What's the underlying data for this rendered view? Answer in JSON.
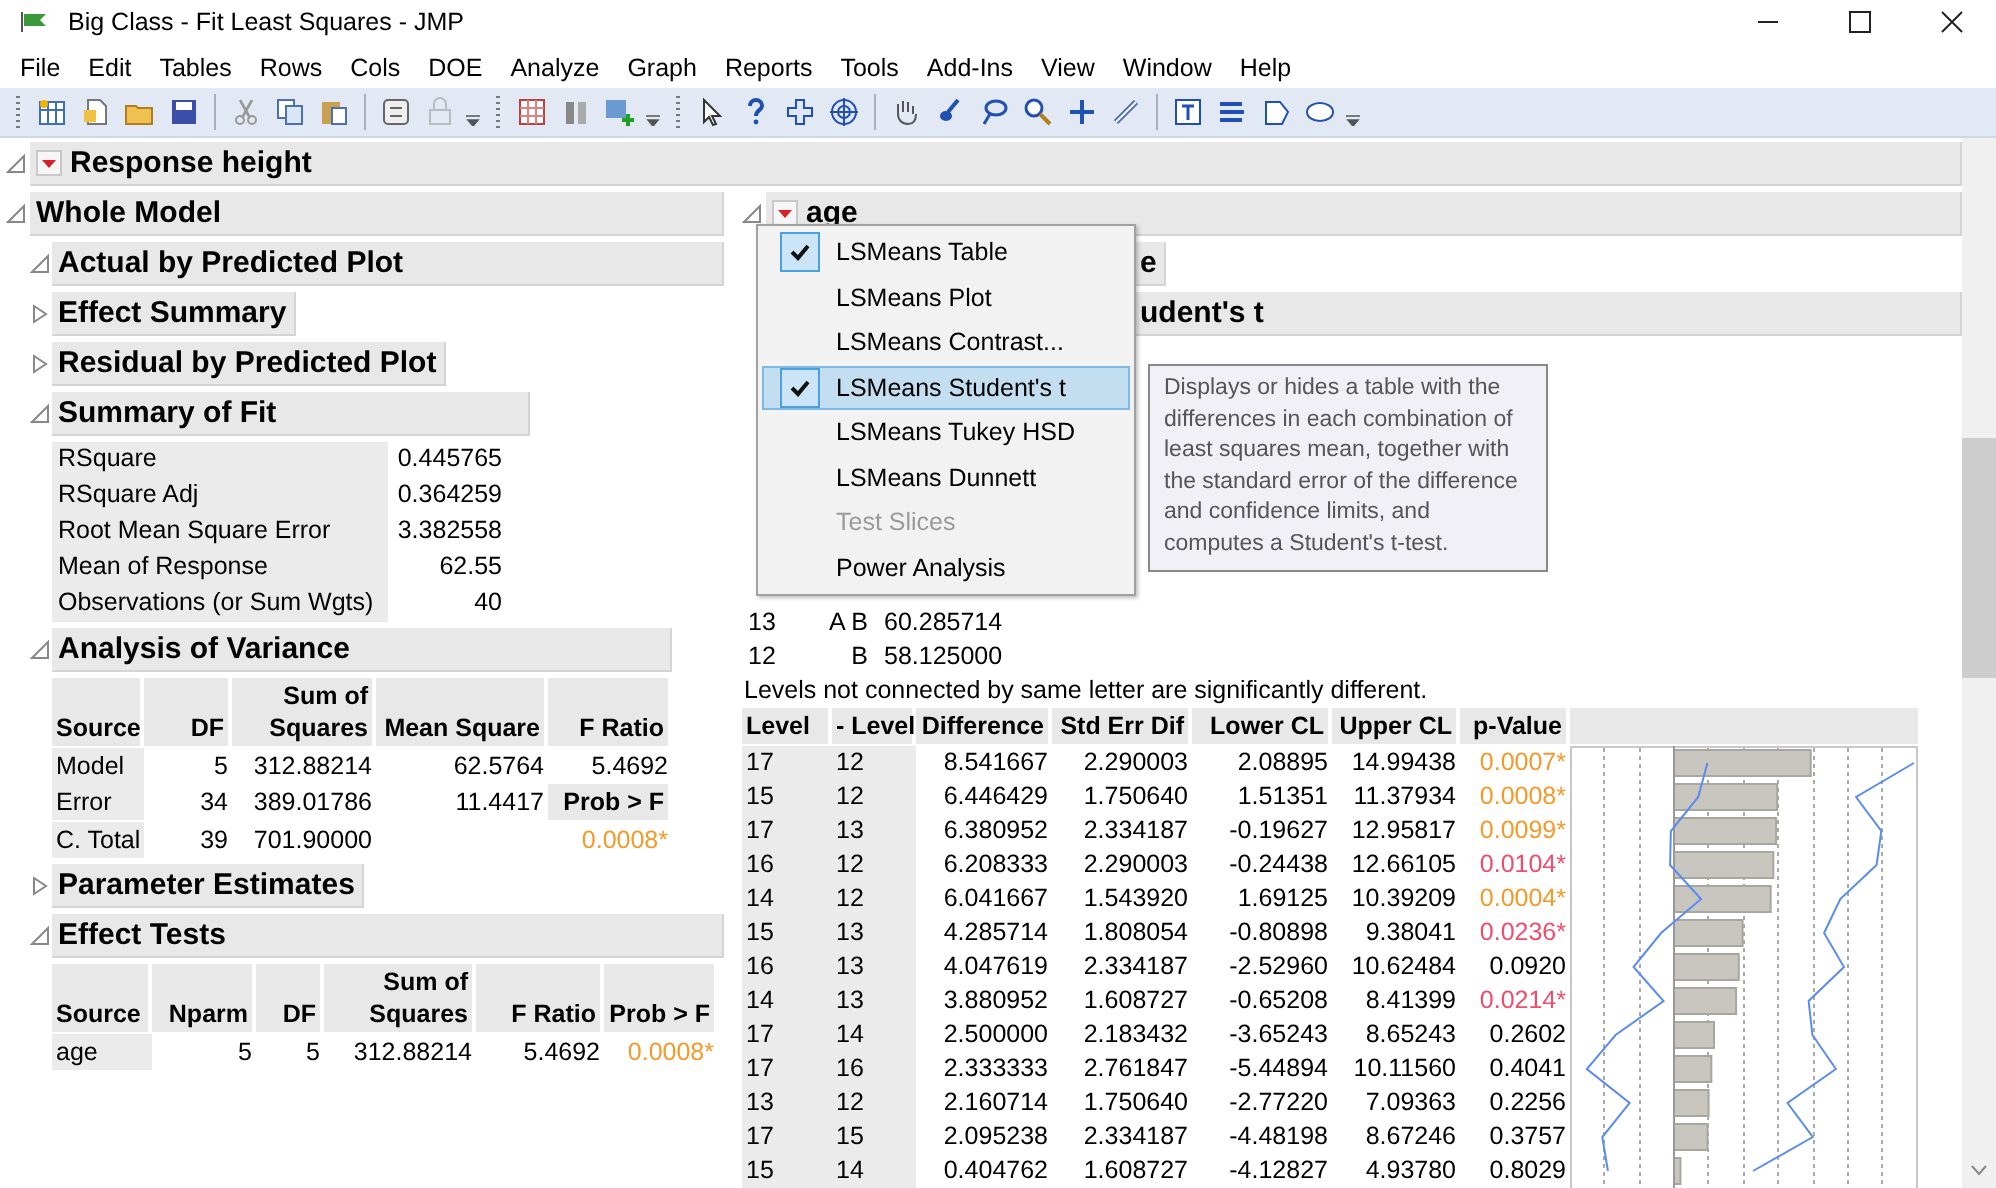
{
  "window": {
    "title": "Big Class - Fit Least Squares - JMP"
  },
  "menu": [
    "File",
    "Edit",
    "Tables",
    "Rows",
    "Cols",
    "DOE",
    "Analyze",
    "Graph",
    "Reports",
    "Tools",
    "Add-Ins",
    "View",
    "Window",
    "Help"
  ],
  "report": {
    "title": "Response height",
    "expanded": true
  },
  "whole_model": {
    "title": "Whole Model",
    "expanded": true
  },
  "sections": [
    {
      "title": "Actual by Predicted Plot",
      "expanded": true,
      "kind": "plot"
    },
    {
      "title": "Effect Summary",
      "expanded": false,
      "kind": "closed"
    },
    {
      "title": "Residual by Predicted Plot",
      "expanded": false,
      "kind": "closed"
    },
    {
      "title": "Summary of Fit",
      "expanded": true,
      "kind": "summary",
      "rows": [
        {
          "label": "RSquare",
          "value": "0.445765"
        },
        {
          "label": "RSquare Adj",
          "value": "0.364259"
        },
        {
          "label": "Root Mean Square Error",
          "value": "3.382558"
        },
        {
          "label": "Mean of Response",
          "value": "62.55"
        },
        {
          "label": "Observations (or Sum Wgts)",
          "value": "40"
        }
      ]
    },
    {
      "title": "Analysis of Variance",
      "expanded": true,
      "kind": "anova",
      "columns": [
        "Source",
        "DF",
        "Sum of Squares",
        "Mean Square",
        "F Ratio"
      ],
      "rows": [
        {
          "source": "Model",
          "df": "5",
          "ss": "312.88214",
          "ms": "62.5764",
          "f": "5.4692"
        },
        {
          "source": "Error",
          "df": "34",
          "ss": "389.01786",
          "ms": "11.4417",
          "f_header": "Prob > F"
        },
        {
          "source": "C. Total",
          "df": "39",
          "ss": "701.90000",
          "f_value": "0.0008*",
          "color": "#f39a2a"
        }
      ]
    },
    {
      "title": "Parameter Estimates",
      "expanded": false,
      "kind": "closed"
    },
    {
      "title": "Effect Tests",
      "expanded": true,
      "kind": "tests",
      "columns": [
        "Source",
        "Nparm",
        "DF",
        "Sum of Squares",
        "F Ratio",
        "Prob > F"
      ],
      "rows": [
        {
          "cells": [
            "age",
            "5",
            "5",
            "312.88214",
            "5.4692",
            "0.0008*"
          ],
          "color": "#f39a2a"
        }
      ]
    }
  ],
  "age": {
    "title": "age",
    "expanded": true
  },
  "partial_headers": [
    {
      "title": "e"
    },
    {
      "title": "udent's t"
    }
  ],
  "letters": [
    {
      "level": "13",
      "letters": "A B",
      "mean": "60.285714"
    },
    {
      "level": "12",
      "letters": "B",
      "mean": "58.125000"
    }
  ],
  "note": "Levels not connected by same letter are significantly different.",
  "diffs": {
    "columns": [
      "Level",
      "- Level",
      "Difference",
      "Std Err Dif",
      "Lower CL",
      "Upper CL",
      "p-Value"
    ],
    "rows": [
      {
        "level": "17",
        "minus_level": "12",
        "difference": "8.541667",
        "std_err_dif": "2.290003",
        "lower_cl": "2.08895",
        "upper_cl": "14.99438",
        "p_value": "0.0007*",
        "color": "#f39a2a"
      },
      {
        "level": "15",
        "minus_level": "12",
        "difference": "6.446429",
        "std_err_dif": "1.750640",
        "lower_cl": "1.51351",
        "upper_cl": "11.37934",
        "p_value": "0.0008*",
        "color": "#f39a2a"
      },
      {
        "level": "17",
        "minus_level": "13",
        "difference": "6.380952",
        "std_err_dif": "2.334187",
        "lower_cl": "-0.19627",
        "upper_cl": "12.95817",
        "p_value": "0.0099*",
        "color": "#f39a2a"
      },
      {
        "level": "16",
        "minus_level": "12",
        "difference": "6.208333",
        "std_err_dif": "2.290003",
        "lower_cl": "-0.24438",
        "upper_cl": "12.66105",
        "p_value": "0.0104*",
        "color": "#f04c6c"
      },
      {
        "level": "14",
        "minus_level": "12",
        "difference": "6.041667",
        "std_err_dif": "1.543920",
        "lower_cl": "1.69125",
        "upper_cl": "10.39209",
        "p_value": "0.0004*",
        "color": "#f39a2a"
      },
      {
        "level": "15",
        "minus_level": "13",
        "difference": "4.285714",
        "std_err_dif": "1.808054",
        "lower_cl": "-0.80898",
        "upper_cl": "9.38041",
        "p_value": "0.0236*",
        "color": "#f04c6c"
      },
      {
        "level": "16",
        "minus_level": "13",
        "difference": "4.047619",
        "std_err_dif": "2.334187",
        "lower_cl": "-2.52960",
        "upper_cl": "10.62484",
        "p_value": "0.0920"
      },
      {
        "level": "14",
        "minus_level": "13",
        "difference": "3.880952",
        "std_err_dif": "1.608727",
        "lower_cl": "-0.65208",
        "upper_cl": "8.41399",
        "p_value": "0.0214*",
        "color": "#f04c6c"
      },
      {
        "level": "17",
        "minus_level": "14",
        "difference": "2.500000",
        "std_err_dif": "2.183432",
        "lower_cl": "-3.65243",
        "upper_cl": "8.65243",
        "p_value": "0.2602"
      },
      {
        "level": "17",
        "minus_level": "16",
        "difference": "2.333333",
        "std_err_dif": "2.761847",
        "lower_cl": "-5.44894",
        "upper_cl": "10.11560",
        "p_value": "0.4041"
      },
      {
        "level": "13",
        "minus_level": "12",
        "difference": "2.160714",
        "std_err_dif": "1.750640",
        "lower_cl": "-2.77220",
        "upper_cl": "7.09363",
        "p_value": "0.2256"
      },
      {
        "level": "17",
        "minus_level": "15",
        "difference": "2.095238",
        "std_err_dif": "2.334187",
        "lower_cl": "-4.48198",
        "upper_cl": "8.67246",
        "p_value": "0.3757"
      },
      {
        "level": "15",
        "minus_level": "14",
        "difference": "0.404762",
        "std_err_dif": "1.608727",
        "lower_cl": "-4.12827",
        "upper_cl": "4.93780",
        "p_value": "0.8029"
      }
    ]
  },
  "dropdown": {
    "items": [
      {
        "label": "LSMeans Table",
        "checked": true,
        "disabled": false,
        "selected": false
      },
      {
        "label": "LSMeans Plot",
        "checked": false,
        "disabled": false,
        "selected": false
      },
      {
        "label": "LSMeans Contrast...",
        "checked": false,
        "disabled": false,
        "selected": false
      },
      {
        "label": "LSMeans Student's t",
        "checked": true,
        "disabled": false,
        "selected": true
      },
      {
        "label": "LSMeans Tukey HSD",
        "checked": false,
        "disabled": false,
        "selected": false
      },
      {
        "label": "LSMeans Dunnett",
        "checked": false,
        "disabled": false,
        "selected": false
      },
      {
        "label": "Test Slices",
        "checked": false,
        "disabled": true,
        "selected": false
      },
      {
        "label": "Power Analysis",
        "checked": false,
        "disabled": false,
        "selected": false
      }
    ]
  },
  "tooltip": "Displays or hides a table with the differences in each combination of least squares mean, together with the standard error of the difference and confidence limits, and computes a Student's t-test."
}
